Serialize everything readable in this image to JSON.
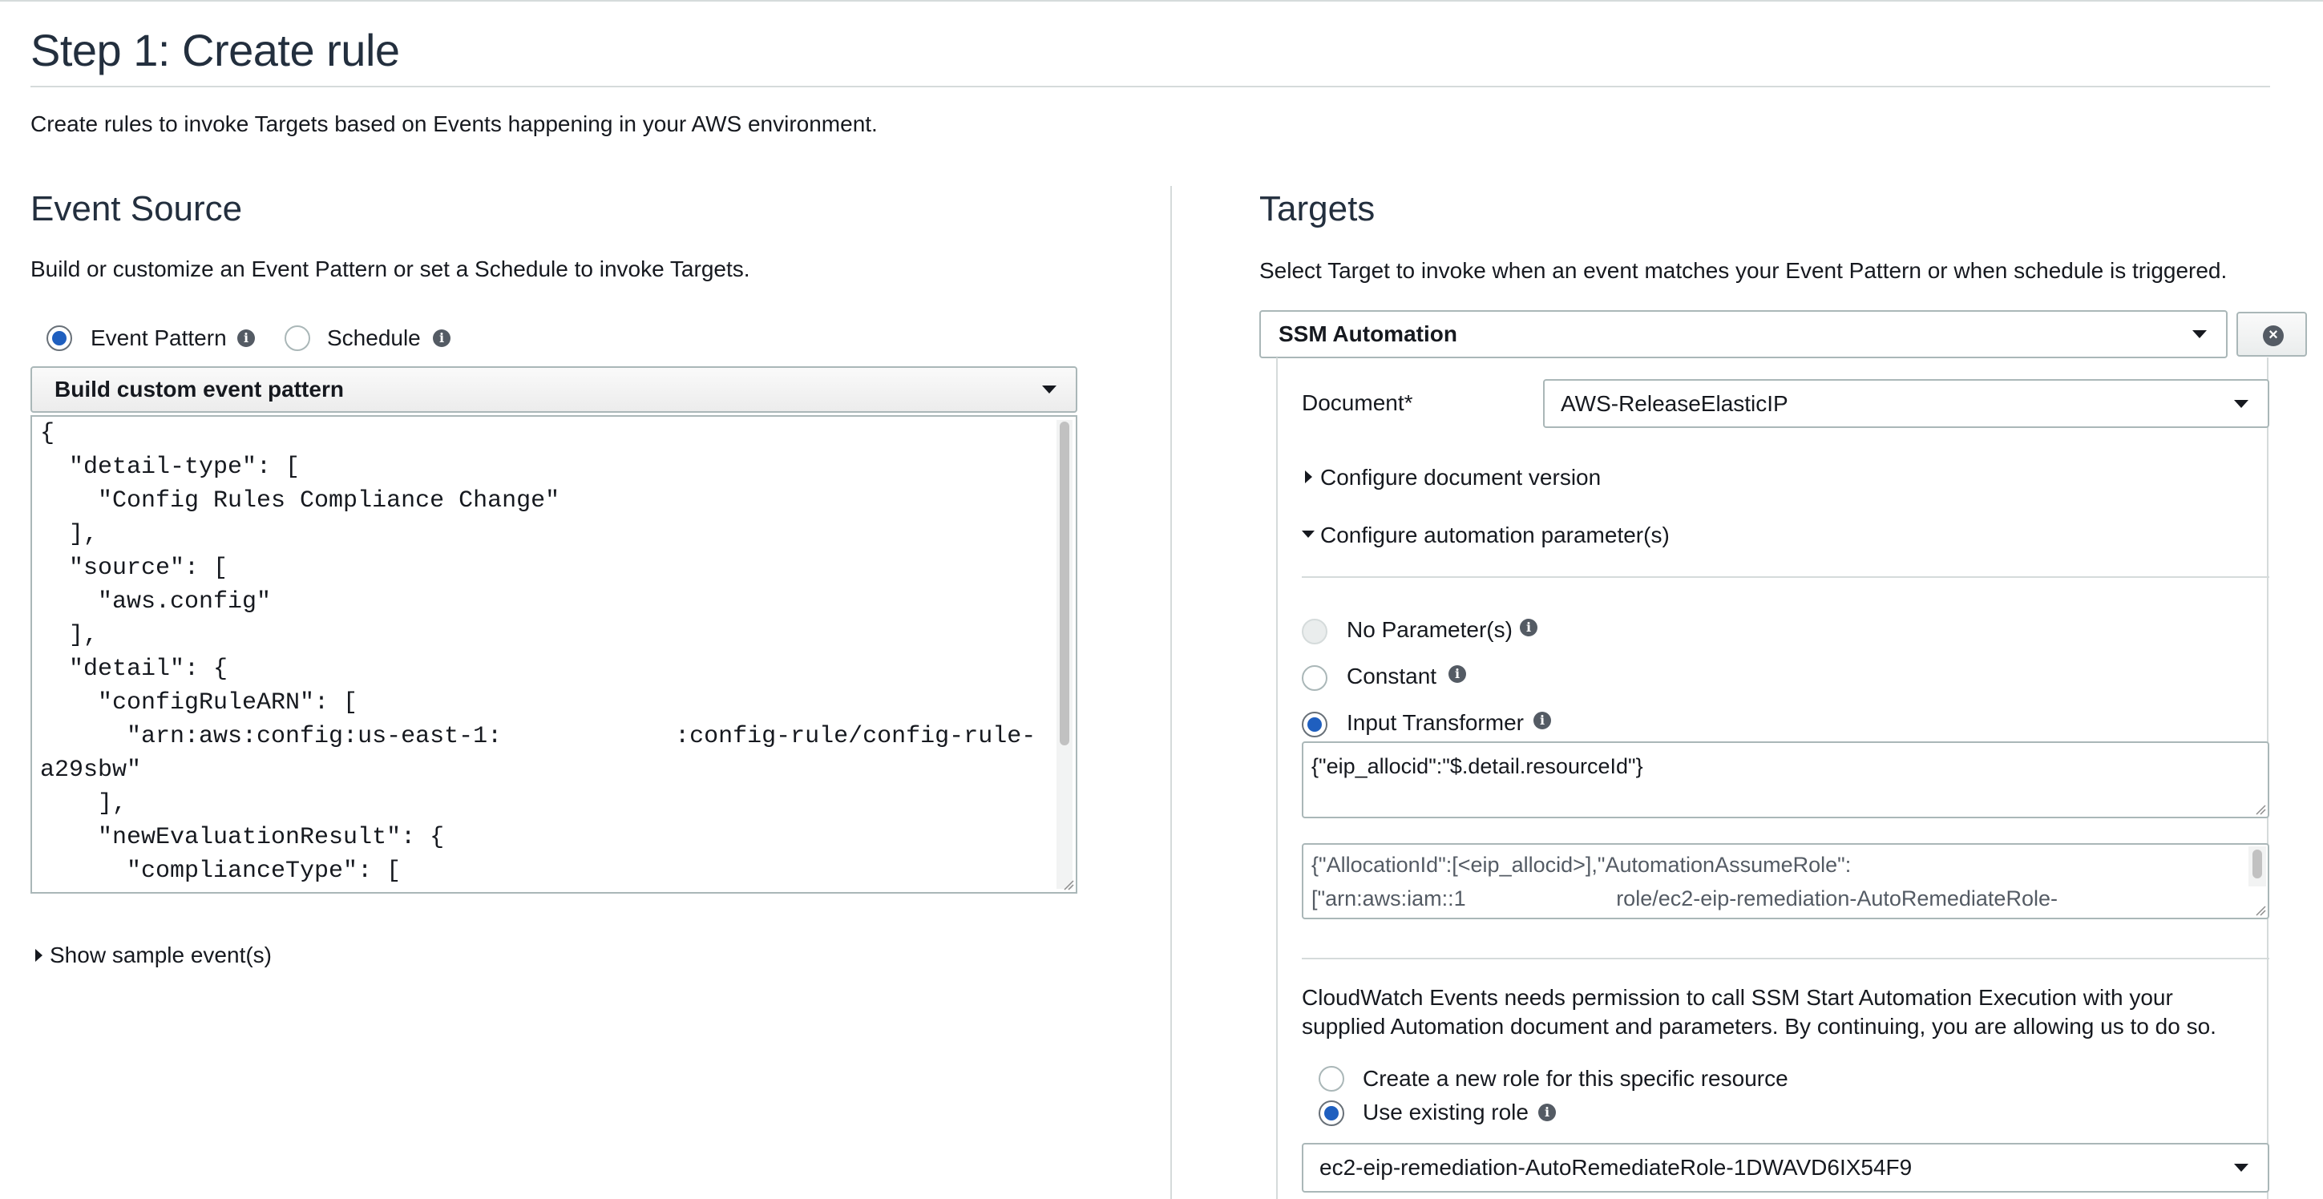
{
  "page": {
    "title": "Step 1: Create rule",
    "description": "Create rules to invoke Targets based on Events happening in your AWS environment."
  },
  "event_source": {
    "title": "Event Source",
    "description": "Build or customize an Event Pattern or set a Schedule to invoke Targets.",
    "radio_event_pattern": "Event Pattern",
    "radio_schedule": "Schedule",
    "selected": "Event Pattern",
    "pattern_select": "Build custom event pattern",
    "pattern_lines": [
      "{",
      "  \"detail-type\": [",
      "    \"Config Rules Compliance Change\"",
      "  ],",
      "  \"source\": [",
      "    \"aws.config\"",
      "  ],",
      "  \"detail\": {",
      "    \"configRuleARN\": [",
      "      \"arn:aws:config:us-east-1:            :config-rule/config-rule-",
      "a29sbw\"",
      "    ],",
      "    \"newEvaluationResult\": {",
      "      \"complianceType\": ["
    ],
    "show_sample": "Show sample event(s)"
  },
  "targets": {
    "title": "Targets",
    "description": "Select Target to invoke when an event matches your Event Pattern or when schedule is triggered.",
    "target_type": "SSM Automation",
    "document_label": "Document*",
    "document_value": "AWS-ReleaseElasticIP",
    "configure_version": "Configure document version",
    "configure_params": "Configure automation parameter(s)",
    "param_options": {
      "none": "No Parameter(s)",
      "constant": "Constant",
      "input_transformer": "Input Transformer"
    },
    "param_selected": "Input Transformer",
    "input_path": "{\"eip_allocid\":\"$.detail.resourceId\"}",
    "input_template_lines": [
      "{\"AllocationId\":[<eip_allocid>],\"AutomationAssumeRole\":",
      "[\"arn:aws:iam::1                         role/ec2-eip-remediation-AutoRemediateRole-"
    ],
    "permission_line1": "CloudWatch Events needs permission to call SSM Start Automation Execution with your",
    "permission_line2": "supplied Automation document and parameters. By continuing, you are allowing us to do so.",
    "role_new": "Create a new role for this specific resource",
    "role_existing": "Use existing role",
    "role_selected": "Use existing role",
    "role_value": "ec2-eip-remediation-AutoRemediateRole-1DWAVD6IX54F9"
  },
  "icons": [
    "info-icon",
    "chevron-down-icon",
    "close-circle-icon",
    "triangle-right-icon",
    "triangle-down-icon",
    "resize-grip-icon"
  ],
  "colors": {
    "accent": "#1f5fbf",
    "border": "#aab7b8",
    "divider": "#d5dbdb",
    "text": "#16191f"
  }
}
